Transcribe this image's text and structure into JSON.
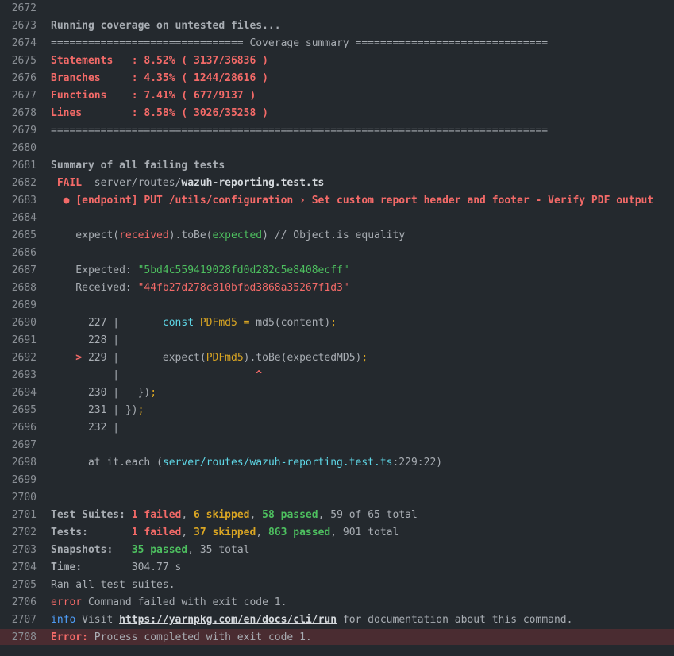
{
  "log": {
    "lines": [
      {
        "n": "2672",
        "segs": []
      },
      {
        "n": "2673",
        "segs": [
          {
            "t": "Running coverage on untested files...",
            "c": "gray bold"
          }
        ]
      },
      {
        "n": "2674",
        "segs": [
          {
            "t": "=============================== Coverage summary ===============================",
            "c": "gray"
          }
        ]
      },
      {
        "n": "2675",
        "segs": [
          {
            "t": "Statements   : 8.52% ( 3137/36836 )",
            "c": "red bold"
          }
        ]
      },
      {
        "n": "2676",
        "segs": [
          {
            "t": "Branches     : 4.35% ( 1244/28616 )",
            "c": "red bold"
          }
        ]
      },
      {
        "n": "2677",
        "segs": [
          {
            "t": "Functions    : 7.41% ( 677/9137 )",
            "c": "red bold"
          }
        ]
      },
      {
        "n": "2678",
        "segs": [
          {
            "t": "Lines        : 8.58% ( 3026/35258 )",
            "c": "red bold"
          }
        ]
      },
      {
        "n": "2679",
        "segs": [
          {
            "t": "================================================================================",
            "c": "gray"
          }
        ]
      },
      {
        "n": "2680",
        "segs": []
      },
      {
        "n": "2681",
        "segs": [
          {
            "t": "Summary of all failing tests",
            "c": "gray bold"
          }
        ]
      },
      {
        "n": "2682",
        "segs": [
          {
            "t": " FAIL ",
            "c": "red bold"
          },
          {
            "t": " server/routes/",
            "c": "gray"
          },
          {
            "t": "wazuh-reporting.test.ts",
            "c": "white bold"
          }
        ]
      },
      {
        "n": "2683",
        "segs": [
          {
            "t": "  ● [endpoint] PUT /utils/configuration › Set custom report header and footer - Verify PDF output",
            "c": "red bold"
          }
        ]
      },
      {
        "n": "2684",
        "segs": []
      },
      {
        "n": "2685",
        "segs": [
          {
            "t": "    expect(",
            "c": "gray"
          },
          {
            "t": "received",
            "c": "red"
          },
          {
            "t": ").toBe(",
            "c": "gray"
          },
          {
            "t": "expected",
            "c": "green"
          },
          {
            "t": ") // Object.is equality",
            "c": "gray"
          }
        ]
      },
      {
        "n": "2686",
        "segs": []
      },
      {
        "n": "2687",
        "segs": [
          {
            "t": "    Expected: ",
            "c": "gray"
          },
          {
            "t": "\"5bd4c559419028fd0d282c5e8408ecff\"",
            "c": "green"
          }
        ]
      },
      {
        "n": "2688",
        "segs": [
          {
            "t": "    Received: ",
            "c": "gray"
          },
          {
            "t": "\"44fb27d278c810bfbd3868a35267f1d3\"",
            "c": "red"
          }
        ]
      },
      {
        "n": "2689",
        "segs": []
      },
      {
        "n": "2690",
        "segs": [
          {
            "t": "      227 |       ",
            "c": "gray"
          },
          {
            "t": "const",
            "c": "cyan"
          },
          {
            "t": " ",
            "c": "gray"
          },
          {
            "t": "PDFmd5",
            "c": "yellow"
          },
          {
            "t": " ",
            "c": "gray"
          },
          {
            "t": "=",
            "c": "yellow"
          },
          {
            "t": " md5(content)",
            "c": "gray"
          },
          {
            "t": ";",
            "c": "yellow"
          }
        ]
      },
      {
        "n": "2691",
        "segs": [
          {
            "t": "      228 |",
            "c": "gray"
          }
        ]
      },
      {
        "n": "2692",
        "segs": [
          {
            "t": "    > ",
            "c": "red bold"
          },
          {
            "t": "229 |       expect(",
            "c": "gray"
          },
          {
            "t": "PDFmd5",
            "c": "yellow"
          },
          {
            "t": ").toBe(expectedMD5)",
            "c": "gray"
          },
          {
            "t": ";",
            "c": "yellow"
          }
        ]
      },
      {
        "n": "2693",
        "segs": [
          {
            "t": "          |                      ",
            "c": "gray"
          },
          {
            "t": "^",
            "c": "red bold"
          }
        ]
      },
      {
        "n": "2694",
        "segs": [
          {
            "t": "      230 |   })",
            "c": "gray"
          },
          {
            "t": ";",
            "c": "yellow"
          }
        ]
      },
      {
        "n": "2695",
        "segs": [
          {
            "t": "      231 | })",
            "c": "gray"
          },
          {
            "t": ";",
            "c": "yellow"
          }
        ]
      },
      {
        "n": "2696",
        "segs": [
          {
            "t": "      232 |",
            "c": "gray"
          }
        ]
      },
      {
        "n": "2697",
        "segs": []
      },
      {
        "n": "2698",
        "segs": [
          {
            "t": "      at it.each (",
            "c": "gray"
          },
          {
            "t": "server/routes/wazuh-reporting.test.ts",
            "c": "cyan"
          },
          {
            "t": ":229:22)",
            "c": "gray"
          }
        ]
      },
      {
        "n": "2699",
        "segs": []
      },
      {
        "n": "2700",
        "segs": []
      },
      {
        "n": "2701",
        "segs": [
          {
            "t": "Test Suites: ",
            "c": "gray bold"
          },
          {
            "t": "1 failed",
            "c": "red bold"
          },
          {
            "t": ", ",
            "c": "gray"
          },
          {
            "t": "6 skipped",
            "c": "yellow bold"
          },
          {
            "t": ", ",
            "c": "gray"
          },
          {
            "t": "58 passed",
            "c": "green bold"
          },
          {
            "t": ", 59 of 65 total",
            "c": "gray"
          }
        ]
      },
      {
        "n": "2702",
        "segs": [
          {
            "t": "Tests:       ",
            "c": "gray bold"
          },
          {
            "t": "1 failed",
            "c": "red bold"
          },
          {
            "t": ", ",
            "c": "gray"
          },
          {
            "t": "37 skipped",
            "c": "yellow bold"
          },
          {
            "t": ", ",
            "c": "gray"
          },
          {
            "t": "863 passed",
            "c": "green bold"
          },
          {
            "t": ", 901 total",
            "c": "gray"
          }
        ]
      },
      {
        "n": "2703",
        "segs": [
          {
            "t": "Snapshots:   ",
            "c": "gray bold"
          },
          {
            "t": "35 passed",
            "c": "green bold"
          },
          {
            "t": ", 35 total",
            "c": "gray"
          }
        ]
      },
      {
        "n": "2704",
        "segs": [
          {
            "t": "Time:        ",
            "c": "gray bold"
          },
          {
            "t": "304.77 s",
            "c": "gray"
          }
        ]
      },
      {
        "n": "2705",
        "segs": [
          {
            "t": "Ran all test suites.",
            "c": "gray"
          }
        ]
      },
      {
        "n": "2706",
        "segs": [
          {
            "t": "error",
            "c": "red"
          },
          {
            "t": " Command failed with exit code 1.",
            "c": "gray"
          }
        ]
      },
      {
        "n": "2707",
        "segs": [
          {
            "t": "info",
            "c": "blue"
          },
          {
            "t": " Visit ",
            "c": "gray"
          },
          {
            "t": "https://yarnpkg.com/en/docs/cli/run",
            "c": "white bold link"
          },
          {
            "t": " for documentation about this command.",
            "c": "gray"
          }
        ]
      },
      {
        "n": "2708",
        "highlight": true,
        "segs": [
          {
            "t": "Error:",
            "c": "red bold"
          },
          {
            "t": " Process completed with exit code 1.",
            "c": "gray"
          }
        ]
      }
    ]
  }
}
